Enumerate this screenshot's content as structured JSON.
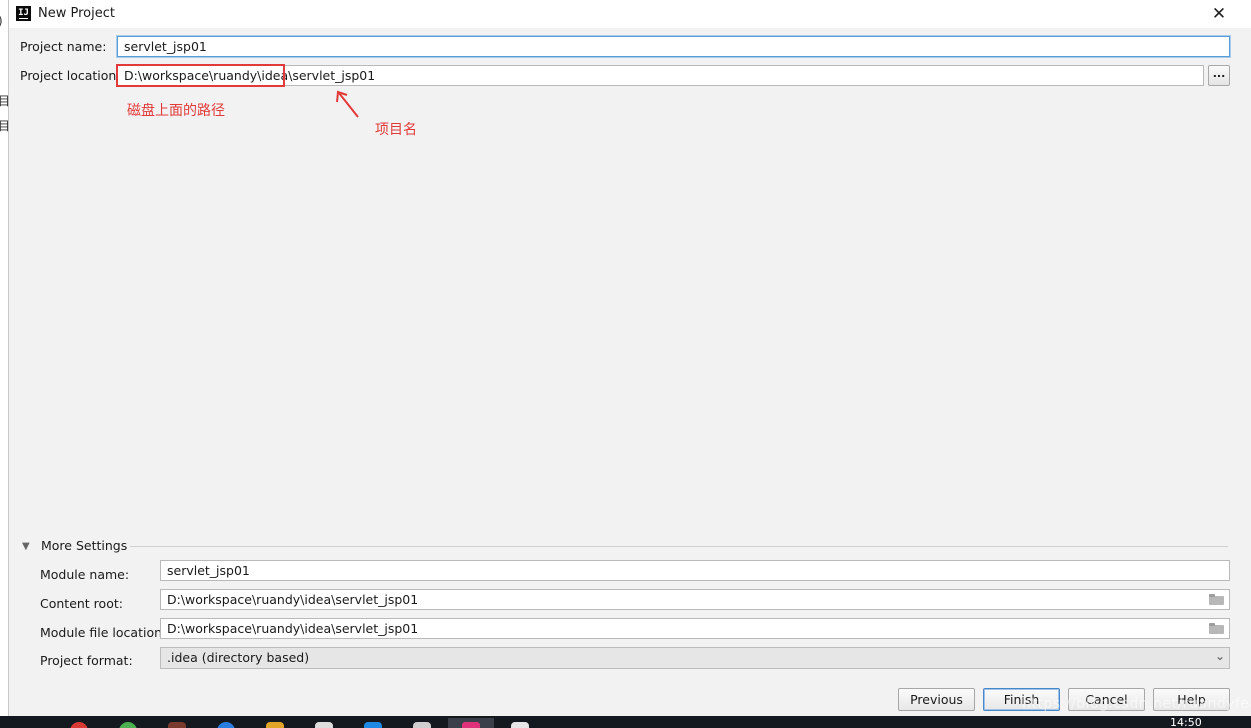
{
  "window": {
    "app_icon": "IJ",
    "title": "New Project",
    "close_glyph": "✕"
  },
  "background": {
    "glyphs": [
      ")",
      "目",
      "目"
    ]
  },
  "project": {
    "name_label": "Project name:",
    "name_value": "servlet_jsp01",
    "location_label": "Project location:",
    "location_value": "D:\\workspace\\ruandy\\idea\\servlet_jsp01",
    "browse_label": "..."
  },
  "annotations": {
    "disk_path": "磁盘上面的路径",
    "project_name": "项目名",
    "color": "#e23a3a"
  },
  "more_settings": {
    "toggle_glyph": "▼",
    "label": "More Settings",
    "module_name_label": "Module name:",
    "module_name_value": "servlet_jsp01",
    "content_root_label": "Content root:",
    "content_root_value": "D:\\workspace\\ruandy\\idea\\servlet_jsp01",
    "module_file_label": "Module file location:",
    "module_file_value": "D:\\workspace\\ruandy\\idea\\servlet_jsp01",
    "format_label": "Project format:",
    "format_value": ".idea (directory based)",
    "format_chevron": "⌄"
  },
  "buttons": {
    "previous": "Previous",
    "finish": "Finish",
    "cancel": "Cancel",
    "help": "Help"
  },
  "taskbar": {
    "time": "14:50",
    "watermark": "https://blog.csdn.net/ruandyfeam"
  },
  "colors": {
    "focus_border": "#5d9bd4",
    "default_button_border": "#4a87c7",
    "dialog_bg": "#f2f2f2"
  }
}
